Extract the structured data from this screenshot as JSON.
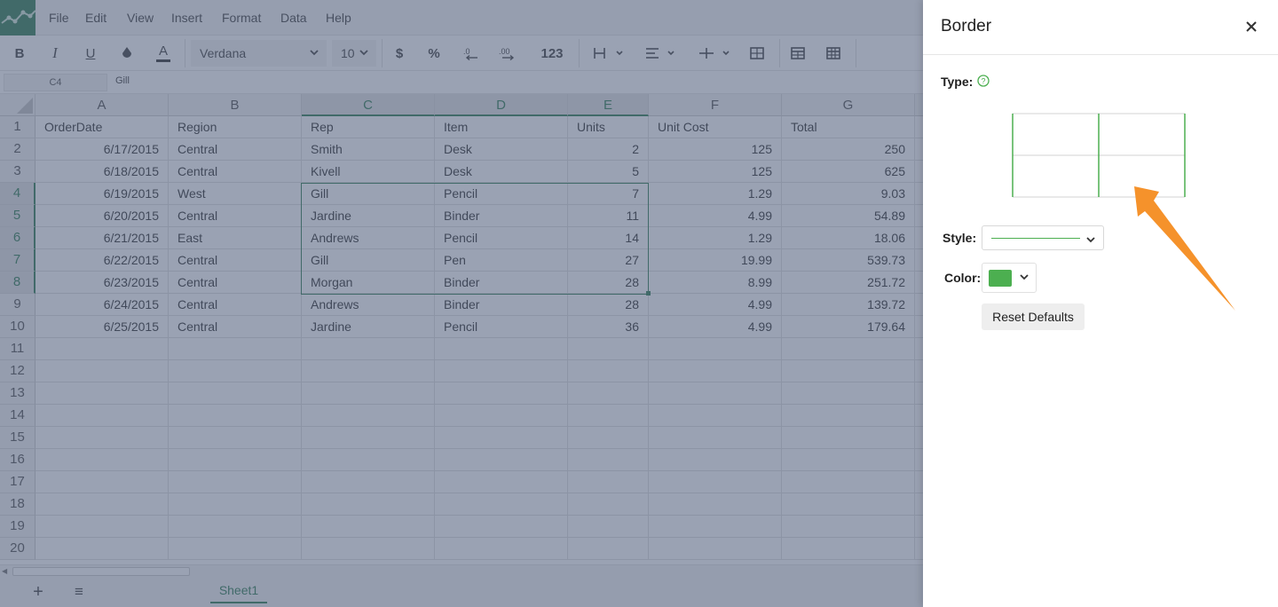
{
  "menu": [
    "File",
    "Edit",
    "View",
    "Insert",
    "Format",
    "Data",
    "Help"
  ],
  "toolbar": {
    "bold": "B",
    "italic": "I",
    "underline": "U",
    "font_color": "A",
    "font_name": "Verdana",
    "font_size": "10",
    "currency": "$",
    "percent": "%",
    "number_format": "123"
  },
  "formula_bar": {
    "cell_ref": "C4",
    "value": "Gill"
  },
  "columns": [
    "A",
    "B",
    "C",
    "D",
    "E",
    "F",
    "G"
  ],
  "selected_columns": [
    "C",
    "D",
    "E"
  ],
  "selected_rows": [
    4,
    5,
    6,
    7,
    8
  ],
  "row_numbers": [
    1,
    2,
    3,
    4,
    5,
    6,
    7,
    8,
    9,
    10,
    11,
    12,
    13,
    14,
    15,
    16,
    17,
    18,
    19,
    20
  ],
  "headers": [
    "OrderDate",
    "Region",
    "Rep",
    "Item",
    "Units",
    "Unit Cost",
    "Total"
  ],
  "rows": [
    [
      "6/17/2015",
      "Central",
      "Smith",
      "Desk",
      "2",
      "125",
      "250"
    ],
    [
      "6/18/2015",
      "Central",
      "Kivell",
      "Desk",
      "5",
      "125",
      "625"
    ],
    [
      "6/19/2015",
      "West",
      "Gill",
      "Pencil",
      "7",
      "1.29",
      "9.03"
    ],
    [
      "6/20/2015",
      "Central",
      "Jardine",
      "Binder",
      "11",
      "4.99",
      "54.89"
    ],
    [
      "6/21/2015",
      "East",
      "Andrews",
      "Pencil",
      "14",
      "1.29",
      "18.06"
    ],
    [
      "6/22/2015",
      "Central",
      "Gill",
      "Pen",
      "27",
      "19.99",
      "539.73"
    ],
    [
      "6/23/2015",
      "Central",
      "Morgan",
      "Binder",
      "28",
      "8.99",
      "251.72"
    ],
    [
      "6/24/2015",
      "Central",
      "Andrews",
      "Binder",
      "28",
      "4.99",
      "139.72"
    ],
    [
      "6/25/2015",
      "Central",
      "Jardine",
      "Pencil",
      "36",
      "4.99",
      "179.64"
    ]
  ],
  "sheet_tabs": [
    "Sheet1"
  ],
  "panel": {
    "title": "Border",
    "type_label": "Type:",
    "style_label": "Style:",
    "color_label": "Color:",
    "reset_label": "Reset Defaults",
    "border_color": "#4caf50"
  },
  "colors": {
    "accent": "#217346",
    "overlay": "#566480",
    "callout_arrow": "#f5922b"
  }
}
